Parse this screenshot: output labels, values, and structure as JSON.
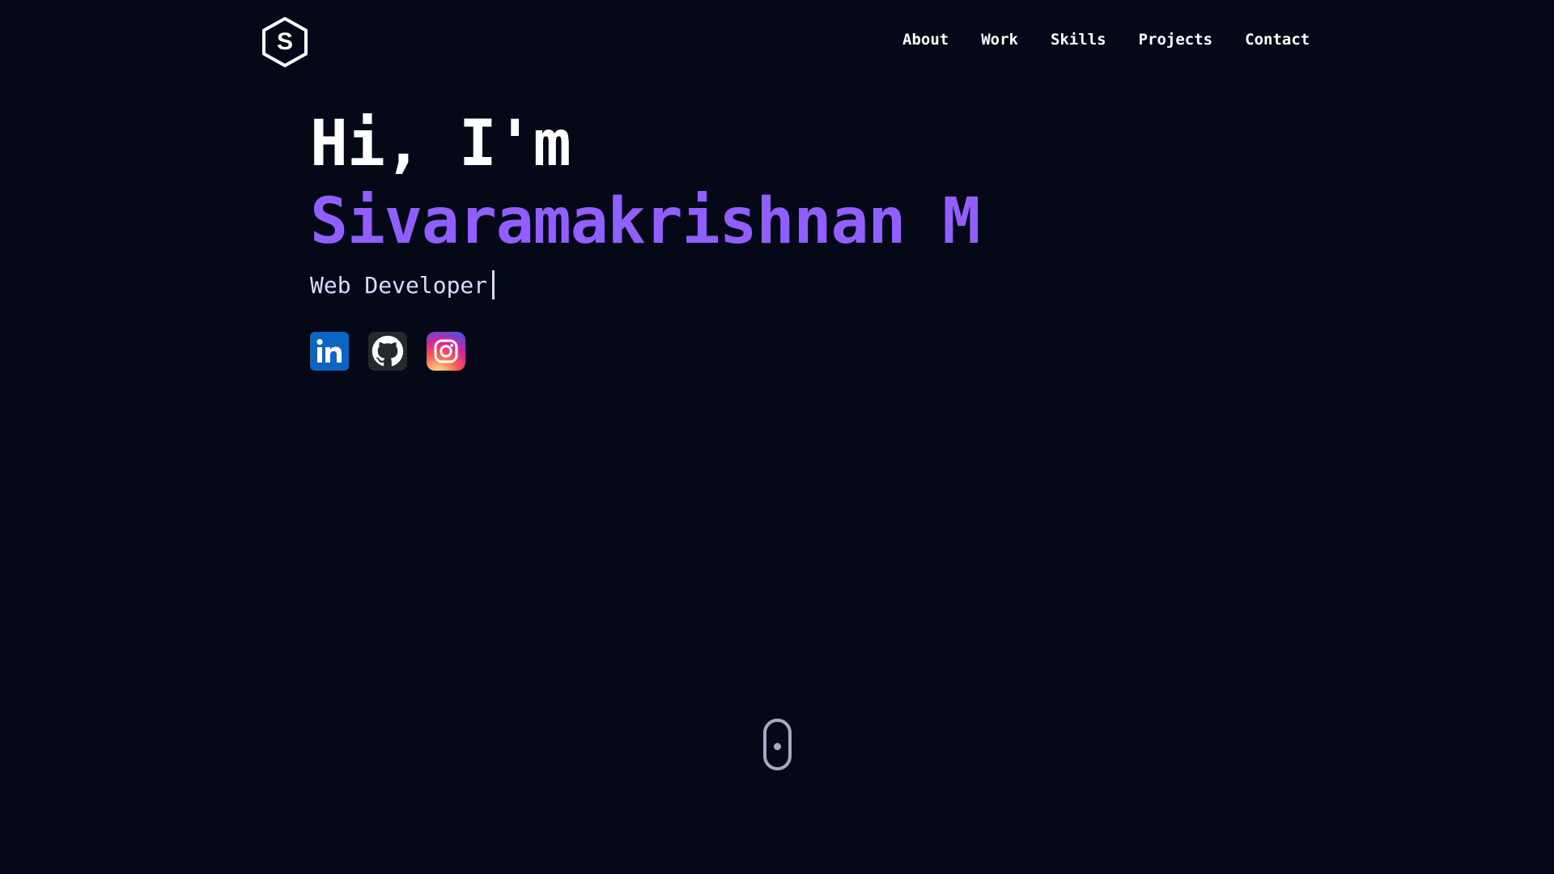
{
  "brand": {
    "logo_letter": "S",
    "logo_icon": "hexagon-s-logo-icon"
  },
  "nav": {
    "items": [
      {
        "label": "About"
      },
      {
        "label": "Work"
      },
      {
        "label": "Skills"
      },
      {
        "label": "Projects"
      },
      {
        "label": "Contact"
      }
    ]
  },
  "hero": {
    "greeting": "Hi, I'm",
    "name": "Sivaramakrishnan M",
    "role": "Web Developer"
  },
  "socials": [
    {
      "name": "LinkedIn",
      "icon": "linkedin-icon"
    },
    {
      "name": "GitHub",
      "icon": "github-icon"
    },
    {
      "name": "Instagram",
      "icon": "instagram-icon"
    }
  ],
  "scroll_indicator": {
    "icon": "mouse-scroll-icon"
  },
  "colors": {
    "background": "#050816",
    "accent": "#915eff",
    "text": "#ffffff",
    "secondary_text": "#dfd9ff",
    "indicator": "#aaa6c3"
  }
}
